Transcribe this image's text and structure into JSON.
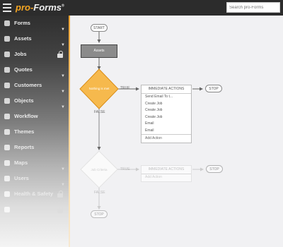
{
  "app": {
    "logo_text": "pro-Forms",
    "trademark": "®"
  },
  "search": {
    "placeholder": "Search pro-Forms"
  },
  "sidebar": {
    "items": [
      {
        "label": "Forms",
        "icon": "pencil-icon"
      },
      {
        "label": "Assets",
        "icon": "cube-icon"
      },
      {
        "label": "Jobs",
        "icon": "calendar-icon"
      },
      {
        "label": "Quotes",
        "icon": "quote-icon"
      },
      {
        "label": "Customers",
        "icon": "users-icon"
      },
      {
        "label": "Objects",
        "icon": "wrench-icon"
      },
      {
        "label": "Workflow",
        "icon": "sitemap-icon"
      },
      {
        "label": "Themes",
        "icon": "palette-icon"
      },
      {
        "label": "Reports",
        "icon": "chart-icon"
      },
      {
        "label": "Maps",
        "icon": "map-icon"
      },
      {
        "label": "Users",
        "icon": "user-icon"
      },
      {
        "label": "Health & Safety",
        "icon": "shield-icon"
      },
      {
        "label": "",
        "icon": "cog-icon"
      }
    ]
  },
  "workflow": {
    "start": "START",
    "assets_node": "Assets",
    "diamond1": "Nothing is met",
    "true_label": "TRUE",
    "false_label": "FALSE",
    "stop": "STOP",
    "actions1": {
      "header": "IMMEDIATE ACTIONS",
      "items": [
        "Send Email To t...",
        "Create Job",
        "Create Job",
        "Create Job",
        "Email",
        "Email"
      ],
      "add": "Add Action"
    },
    "diamond2": "Job Criteria",
    "actions2": {
      "header": "IMMEDIATE ACTIONS",
      "add": "Add Action"
    }
  }
}
